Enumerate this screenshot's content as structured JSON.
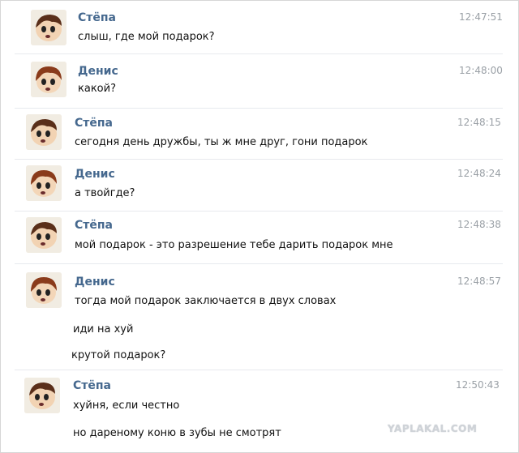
{
  "messages": [
    {
      "author": "Стёпа",
      "time": "12:47:51",
      "lines": [
        "слыш, где мой подарок?"
      ]
    },
    {
      "author": "Денис",
      "time": "12:48:00",
      "lines": [
        "какой?"
      ]
    },
    {
      "author": "Стёпа",
      "time": "12:48:15",
      "lines": [
        "сегодня день дружбы, ты ж мне друг, гони подарок"
      ]
    },
    {
      "author": "Денис",
      "time": "12:48:24",
      "lines": [
        "а твойгде?"
      ]
    },
    {
      "author": "Стёпа",
      "time": "12:48:38",
      "lines": [
        "мой подарок - это разрешение тебе дарить подарок мне"
      ]
    },
    {
      "author": "Денис",
      "time": "12:48:57",
      "lines": [
        "тогда мой подарок заключается в двух словах",
        "иди на хуй",
        "крутой подарок?"
      ]
    },
    {
      "author": "Стёпа",
      "time": "12:50:43",
      "lines": [
        "хуйня, если честно",
        "но дареному коню в зубы не смотрят"
      ]
    }
  ],
  "watermark": "YAPLAKAL.COM"
}
